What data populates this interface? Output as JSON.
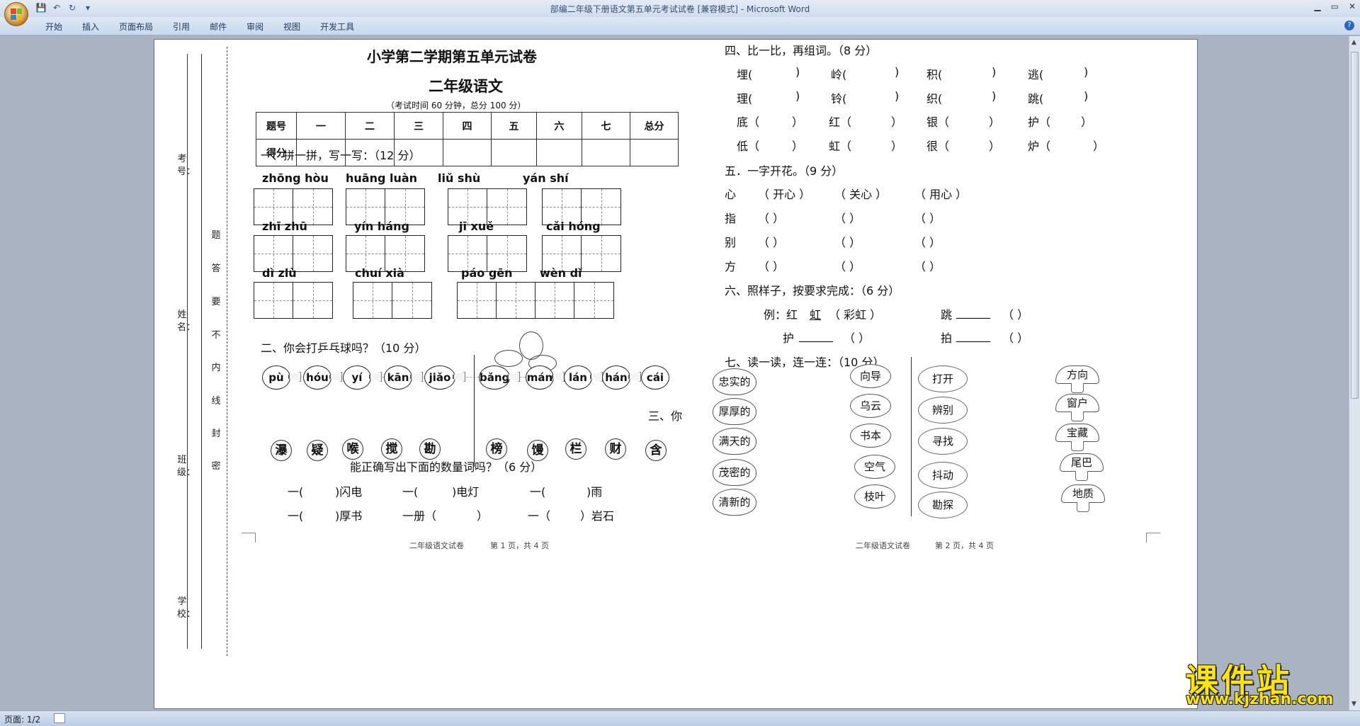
{
  "window": {
    "title": "部编二年级下册语文第五单元考试试卷 [兼容模式] - Microsoft Word"
  },
  "qat": {
    "save": "💾",
    "undo": "↶",
    "redo": "↻",
    "more": "▾"
  },
  "ribbon": {
    "tabs": [
      "开始",
      "插入",
      "页面布局",
      "引用",
      "邮件",
      "审阅",
      "视图",
      "开发工具"
    ],
    "help": "?"
  },
  "statusbar": {
    "page": "页面: 1/2"
  },
  "binding": {
    "exam_no": "考号：",
    "name": "姓名：",
    "class": "班级：",
    "school": "学校：",
    "notice": [
      "题",
      "答",
      "要",
      "不",
      "内",
      "线",
      "封",
      "密"
    ]
  },
  "page1": {
    "title": "小学第二学期第五单元试卷",
    "subtitle": "二年级语文",
    "note": "（考试时间 60 分钟，总分 100 分）",
    "score_table": {
      "row1": [
        "题号",
        "一",
        "二",
        "三",
        "四",
        "五",
        "六",
        "七",
        "总分"
      ],
      "row2": [
        "得分",
        "",
        "",
        "",
        "",
        "",
        "",
        "",
        ""
      ]
    },
    "q1": {
      "title": "一、拼一拼，写一写：（12 分）",
      "pinyin": [
        "zhōng hòu",
        "huāng  luàn",
        "liǔ  shù",
        "yán  shí",
        "zhī zhū",
        "yín háng",
        "jī  xuě",
        "cǎi  hóng",
        "dì    zlù",
        "chuí    xià",
        "páo    gēn",
        "wèn    dǐ"
      ]
    },
    "q2": {
      "title": "二、你会打乒乓球吗？（10 分）",
      "balls": [
        "pù",
        "hóu",
        "yí",
        "kān",
        "jiǎo",
        "bǎng",
        "mán",
        "lán",
        "hán",
        "cái"
      ],
      "chars": [
        "瀑",
        "疑",
        "喉",
        "搅",
        "勘",
        "榜",
        "馒",
        "栏",
        "财",
        "含"
      ]
    },
    "q3": {
      "title_a": "三、你",
      "title_b": "能正确写出下面的数量词吗？（6 分）",
      "row1": [
        "一(",
        ")闪电",
        "一(",
        ")电灯",
        "一(",
        ")雨"
      ],
      "row2": [
        "一(",
        ")厚书",
        "一册（",
        "）",
        "一（",
        "）岩石"
      ]
    },
    "footer": "二年级语文试卷",
    "page_no": "第 1 页，共 4 页"
  },
  "page2": {
    "q4": {
      "title": "四、比一比，再组词。（8 分）",
      "rows": [
        [
          "埋(",
          ")",
          "岭(",
          ")",
          "积(",
          ")",
          "逃(",
          ")"
        ],
        [
          "理(",
          ")",
          "铃(",
          ")",
          "织(",
          ")",
          "跳(",
          ")"
        ],
        [
          "底（",
          "）",
          "红（",
          "）",
          "银（",
          "）",
          "护（",
          "）"
        ],
        [
          "低（",
          "）",
          "虹（",
          "）",
          "很（",
          "）",
          "炉（",
          "）"
        ]
      ]
    },
    "q5": {
      "title": "五．一字开花。（9 分）",
      "rows": [
        [
          "心",
          "（ 开心 ）",
          "（ 关心 ）",
          "（ 用心 ）"
        ],
        [
          "指",
          "（        ）",
          "（        ）",
          "（        ）"
        ],
        [
          "别",
          "（        ）",
          "（        ）",
          "（        ）"
        ],
        [
          "方",
          "（        ）",
          "（        ）",
          "（        ）"
        ]
      ]
    },
    "q6": {
      "title": "六、照样子，按要求完成：（6 分）",
      "ex": "例：红",
      "ex_fill": "虹",
      "ex_word": "（ 彩虹 ）",
      "items": [
        "跳",
        "护",
        "拍"
      ],
      "blank": "______",
      "paren": "（        ）"
    },
    "q7": {
      "title": "七、读一读，连一连：（10 分）",
      "col1": [
        "忠实的",
        "厚厚的",
        "满天的",
        "茂密的",
        "清新的"
      ],
      "col2": [
        "向导",
        "乌云",
        "书本",
        "空气",
        "枝叶"
      ],
      "col3": [
        "打开",
        "辨别",
        "寻找",
        "抖动",
        "勘探"
      ],
      "col4": [
        "方向",
        "窗户",
        "宝藏",
        "尾巴",
        "地质"
      ]
    },
    "footer": "二年级语文试卷",
    "page_no": "第 2 页，共 4 页"
  },
  "watermark": {
    "title": "课件站",
    "url": "www.kjzhan.com"
  },
  "colors": {
    "ribbon": "#cfdcee",
    "workspace": "#a9b3c2",
    "watermark": "#ffe500"
  }
}
